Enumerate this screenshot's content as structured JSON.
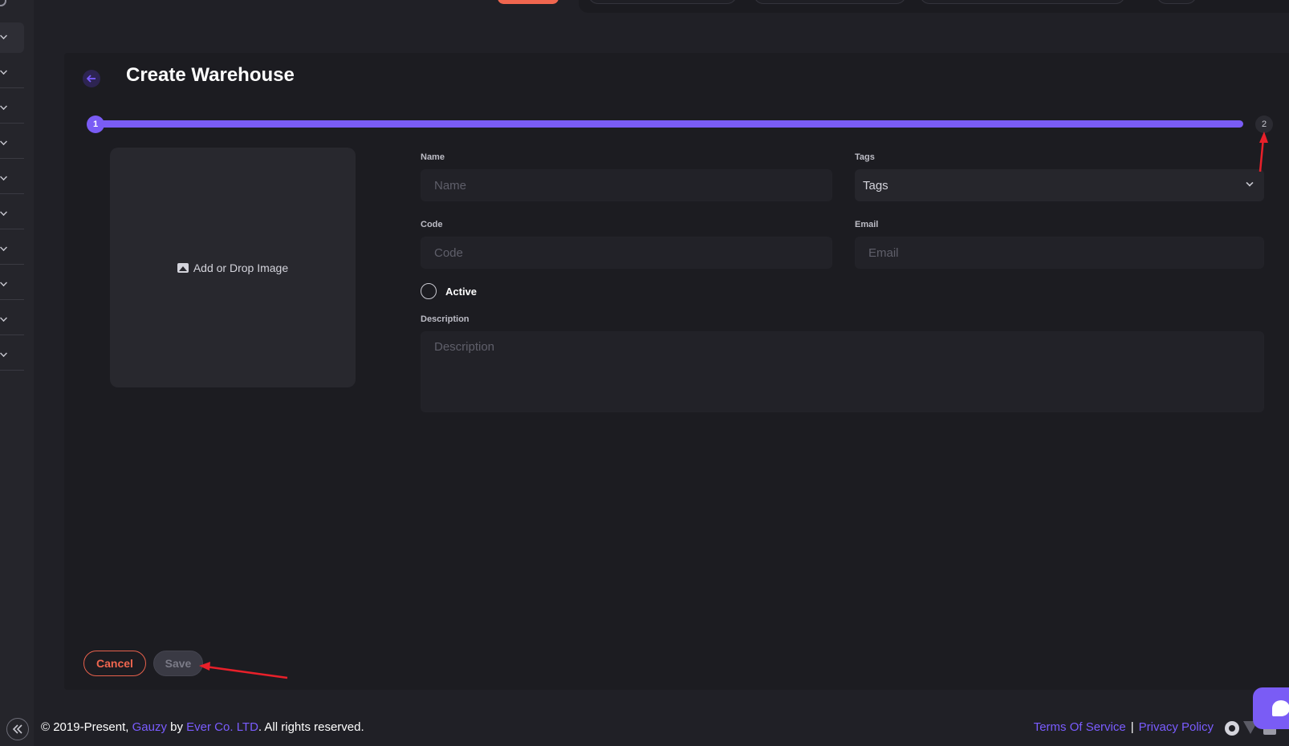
{
  "page": {
    "title": "Create Warehouse"
  },
  "stepper": {
    "step1": "1",
    "step2": "2",
    "progress_percent": 100
  },
  "image_upload": {
    "label": "Add or Drop Image",
    "icon": "image-icon"
  },
  "form": {
    "name": {
      "label": "Name",
      "placeholder": "Name",
      "value": ""
    },
    "tags": {
      "label": "Tags",
      "selected": "Tags"
    },
    "code": {
      "label": "Code",
      "placeholder": "Code",
      "value": ""
    },
    "email": {
      "label": "Email",
      "placeholder": "Email",
      "value": ""
    },
    "active": {
      "label": "Active",
      "checked": false
    },
    "description": {
      "label": "Description",
      "placeholder": "Description",
      "value": ""
    }
  },
  "actions": {
    "cancel_label": "Cancel",
    "save_label": "Save"
  },
  "footer": {
    "copyright_prefix": "© 2019-Present, ",
    "product_link": "Gauzy",
    "by_text": " by ",
    "company_link": "Ever Co. LTD",
    "rights_text": ". All rights reserved.",
    "terms_link": "Terms Of Service",
    "separator": "|",
    "privacy_link": "Privacy Policy"
  },
  "colors": {
    "accent": "#7a5cf5",
    "danger": "#f0664f",
    "background": "#202026",
    "card": "#1c1c21"
  }
}
